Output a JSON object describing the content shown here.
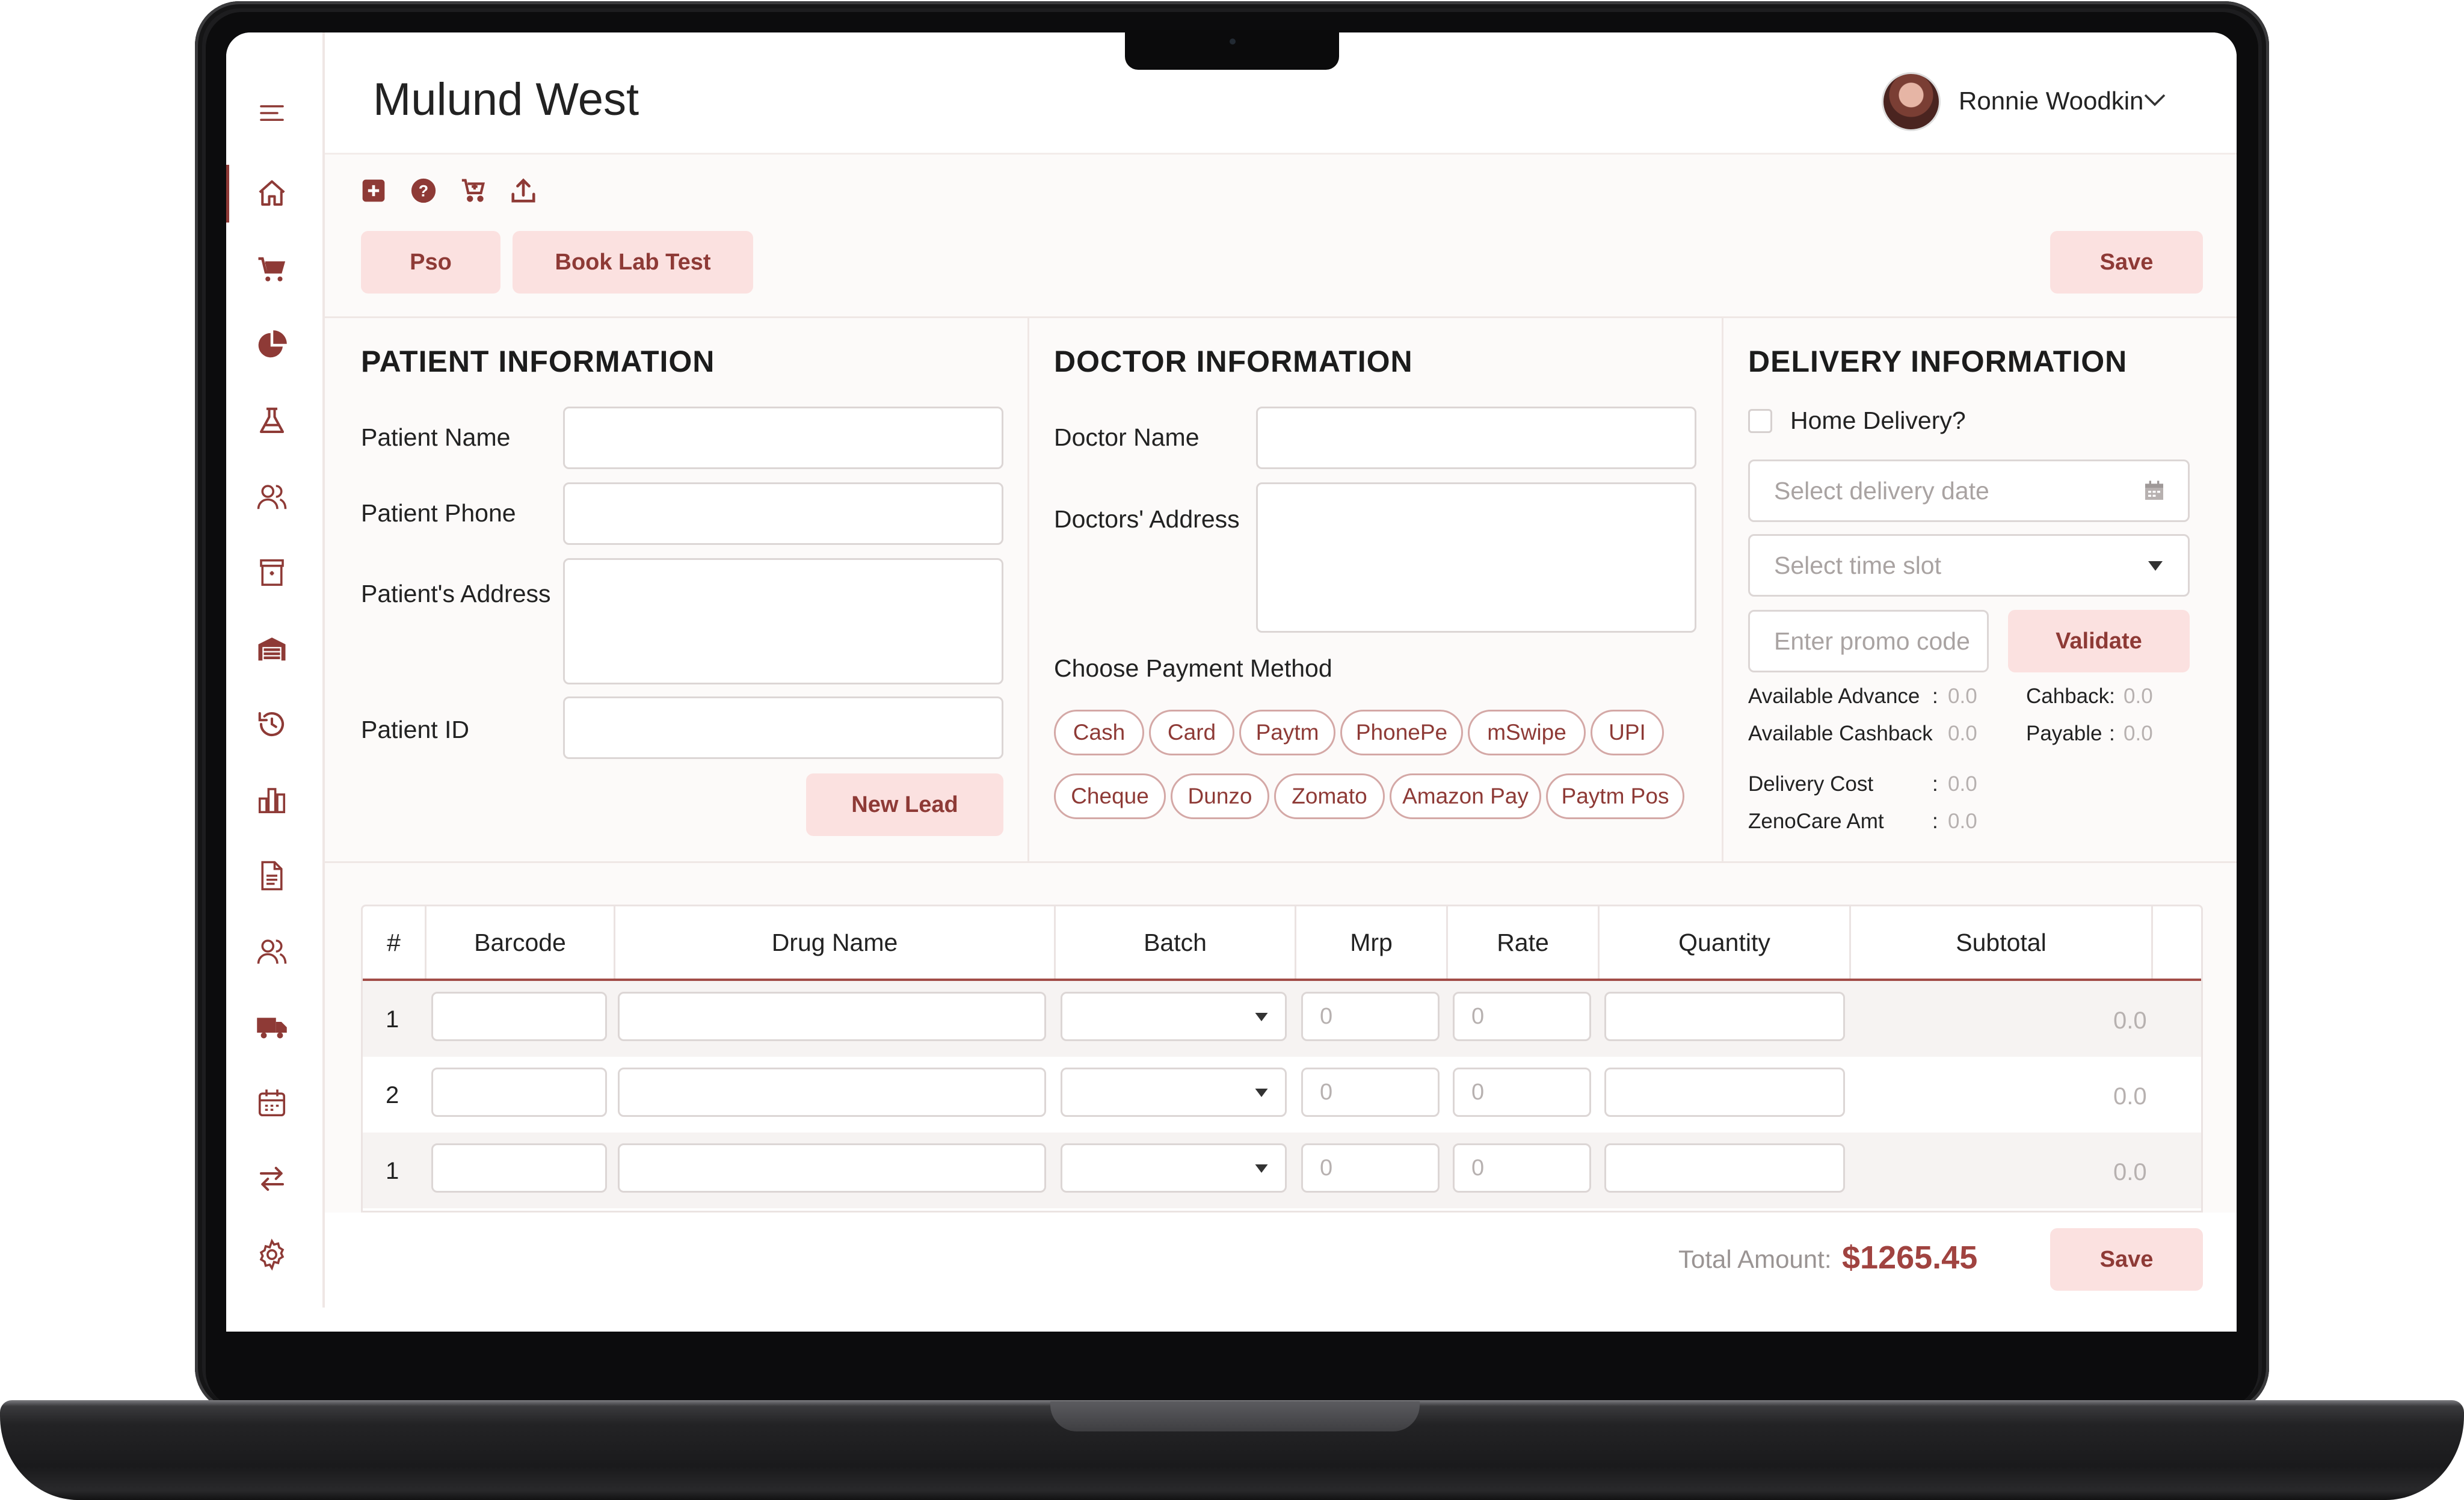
{
  "header": {
    "title": "Mulund West",
    "user_name": "Ronnie Woodkin"
  },
  "sidebar": {
    "items": [
      "menu-icon",
      "home-icon",
      "cart-icon",
      "pie-chart-icon",
      "flask-icon",
      "users-icon",
      "archive-icon",
      "warehouse-icon",
      "history-icon",
      "bar-chart-icon",
      "document-icon",
      "customers-icon",
      "truck-icon",
      "calendar-icon",
      "transfer-icon",
      "settings-icon"
    ],
    "active": "home-icon"
  },
  "toolbar": {
    "icons": [
      "add-icon",
      "help-icon",
      "add-to-cart-icon",
      "upload-icon"
    ],
    "pso_label": "Pso",
    "book_lab_label": "Book Lab Test",
    "save_label": "Save"
  },
  "patient": {
    "section_title": "PATIENT INFORMATION",
    "name_label": "Patient Name",
    "phone_label": "Patient Phone",
    "address_label": "Patient's Address",
    "id_label": "Patient ID",
    "new_lead_label": "New Lead"
  },
  "doctor": {
    "section_title": "DOCTOR INFORMATION",
    "name_label": "Doctor Name",
    "address_label": "Doctors' Address",
    "payment_label": "Choose Payment Method",
    "payment_methods": [
      "Cash",
      "Card",
      "Paytm",
      "PhonePe",
      "mSwipe",
      "UPI",
      "Cheque",
      "Dunzo",
      "Zomato",
      "Amazon Pay",
      "Paytm Pos"
    ]
  },
  "delivery": {
    "section_title": "DELIVERY INFORMATION",
    "home_delivery_label": "Home Delivery?",
    "date_placeholder": "Select delivery date",
    "slot_placeholder": "Select time slot",
    "promo_placeholder": "Enter promo code",
    "validate_label": "Validate",
    "available_advance_label": "Available Advance",
    "available_advance_value": "0.0",
    "cashback_label": "Cahback:",
    "cashback_value": "0.0",
    "available_cashback_label": "Available Cashback",
    "available_cashback_value": "0.0",
    "payable_label": "Payable",
    "payable_value": "0.0",
    "delivery_cost_label": "Delivery Cost",
    "delivery_cost_value": "0.0",
    "zenocare_label": "ZenoCare Amt",
    "zenocare_value": "0.0",
    "colon": ":"
  },
  "table": {
    "headers": [
      "#",
      "Barcode",
      "Drug Name",
      "Batch",
      "Mrp",
      "Rate",
      "Quantity",
      "Subtotal"
    ],
    "rows": [
      {
        "num": "1",
        "mrp": "0",
        "rate": "0",
        "subtotal": "0.0"
      },
      {
        "num": "2",
        "mrp": "0",
        "rate": "0",
        "subtotal": "0.0"
      },
      {
        "num": "1",
        "mrp": "0",
        "rate": "0",
        "subtotal": "0.0"
      }
    ]
  },
  "footer": {
    "total_label": "Total Amount:",
    "total_value": "$1265.45",
    "save_label": "Save"
  },
  "colors": {
    "accent": "#8e3a36",
    "accent_light": "#fbe1e0",
    "total": "#a04340"
  }
}
